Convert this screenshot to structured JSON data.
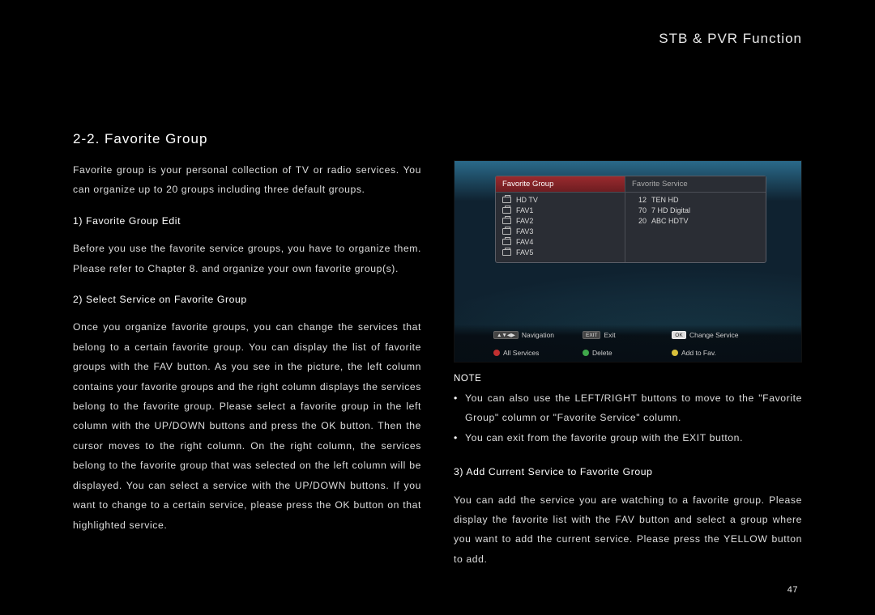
{
  "header": {
    "title": "STB & PVR Function"
  },
  "section": {
    "title": "2-2. Favorite Group"
  },
  "left": {
    "intro": "Favorite group is your personal collection of TV or radio services. You can organize up to 20 groups including three default groups.",
    "sub1_h": "1) Favorite Group Edit",
    "sub1_p": "Before you use the favorite service groups, you have to organize them. Please refer to Chapter 8. and organize your own favorite group(s).",
    "sub2_h": "2) Select Service on Favorite Group",
    "sub2_p": "Once you organize favorite groups, you can change the services that belong to a certain favorite group. You can display the list of favorite groups with the FAV button. As you see in the picture, the left column contains your favorite groups and the right column displays the services belong to the favorite group. Please select a favorite group in the left column with the UP/DOWN buttons and press the OK button. Then the cursor moves to the right column. On the right column, the services belong to the favorite group that was selected on the left column will be displayed. You can select a service with the UP/DOWN buttons. If you want to change to a certain service, please press the OK button on that highlighted service."
  },
  "right": {
    "note_label": "NOTE",
    "note1": "You can also use the LEFT/RIGHT buttons to move to the \"Favorite Group\" column or \"Favorite Service\" column.",
    "note2": "You can exit from the favorite group with the EXIT button.",
    "sub3_h": "3) Add Current Service to Favorite Group",
    "sub3_p": "You can add the service you are watching to a favorite group. Please display the favorite list with the FAV button and select a group where you want to add the current service. Please press the YELLOW button to add."
  },
  "shot": {
    "left_header": "Favorite Group",
    "right_header": "Favorite Service",
    "groups": [
      "HD TV",
      "FAV1",
      "FAV2",
      "FAV3",
      "FAV4",
      "FAV5"
    ],
    "services": [
      {
        "num": "12",
        "name": "TEN HD"
      },
      {
        "num": "70",
        "name": "7 HD Digital"
      },
      {
        "num": "20",
        "name": "ABC HDTV"
      }
    ],
    "footer": {
      "nav": "Navigation",
      "exit_key": "EXIT",
      "exit": "Exit",
      "ok_key": "OK",
      "change": "Change Service",
      "all": "All Services",
      "delete": "Delete",
      "addfav": "Add to Fav."
    }
  },
  "page_number": "47"
}
